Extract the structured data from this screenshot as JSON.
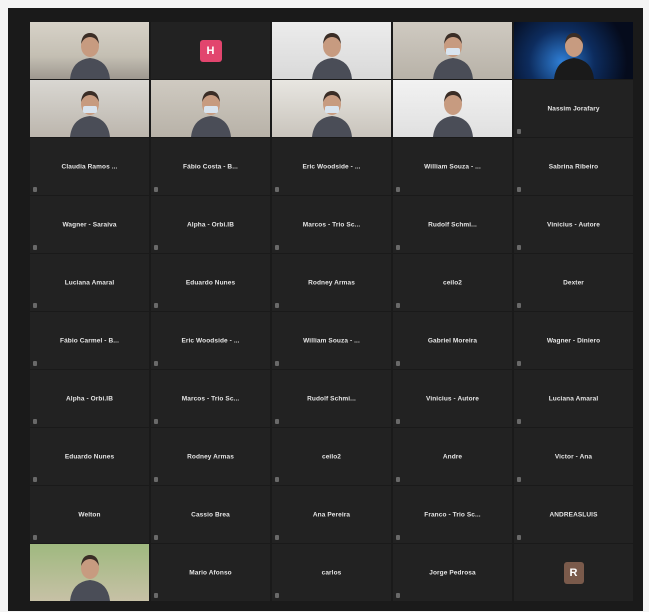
{
  "meeting": {
    "participants": [
      {
        "name": "",
        "video": true,
        "bg": "bg-office",
        "label": ""
      },
      {
        "name": "",
        "avatar": "H",
        "avatar_class": "avatar-h",
        "label": ""
      },
      {
        "name": "",
        "video": true,
        "bg": "bg-white",
        "label": ""
      },
      {
        "name": "",
        "video": true,
        "bg": "bg-room",
        "label": ""
      },
      {
        "name": "",
        "video": true,
        "bg": "bg-space",
        "label": ""
      },
      {
        "name": "",
        "video": true,
        "bg": "bg-lab",
        "label": ""
      },
      {
        "name": "",
        "video": true,
        "bg": "bg-room",
        "label": ""
      },
      {
        "name": "",
        "video": true,
        "bg": "bg-bright",
        "label": ""
      },
      {
        "name": "",
        "video": true,
        "bg": "bg-white2",
        "label": ""
      },
      {
        "name": "Nassim Jorafary"
      },
      {
        "name": "Claudia Ramos ..."
      },
      {
        "name": "Fábio Costa - B..."
      },
      {
        "name": "Eric Woodside - ..."
      },
      {
        "name": "William Souza - ..."
      },
      {
        "name": "Sabrina Ribeiro"
      },
      {
        "name": "Wagner - Saraiva"
      },
      {
        "name": "Alpha - Orbi.IB"
      },
      {
        "name": "Marcos - Trio Sc..."
      },
      {
        "name": "Rudolf Schmi..."
      },
      {
        "name": "Vinicius - Autore"
      },
      {
        "name": "Luciana Amaral"
      },
      {
        "name": "Eduardo Nunes"
      },
      {
        "name": "Rodney Armas"
      },
      {
        "name": "ceilo2"
      },
      {
        "name": "Dexter"
      },
      {
        "name": "Fábio Carmel - B..."
      },
      {
        "name": "Eric Woodside - ..."
      },
      {
        "name": "William Souza - ..."
      },
      {
        "name": "Gabriel Moreira"
      },
      {
        "name": "Wagner - Diniero"
      },
      {
        "name": "Alpha - Orbi.IB"
      },
      {
        "name": "Marcos - Trio Sc..."
      },
      {
        "name": "Rudolf Schmi..."
      },
      {
        "name": "Vinicius - Autore"
      },
      {
        "name": "Luciana Amaral"
      },
      {
        "name": "Eduardo Nunes"
      },
      {
        "name": "Rodney Armas"
      },
      {
        "name": "ceilo2"
      },
      {
        "name": "Andre"
      },
      {
        "name": "Victor - Ana"
      },
      {
        "name": "Welton"
      },
      {
        "name": "Cassio Brea"
      },
      {
        "name": "Ana Pereira"
      },
      {
        "name": "Franco - Trio Sc..."
      },
      {
        "name": "ANDREASLUIS"
      },
      {
        "name": "",
        "video": true,
        "bg": "bg-green",
        "label": ""
      },
      {
        "name": "Mario Afonso"
      },
      {
        "name": "carlos"
      },
      {
        "name": "Jorge Pedrosa"
      },
      {
        "name": "",
        "avatar": "R",
        "avatar_class": "avatar-r",
        "label": ""
      }
    ]
  }
}
